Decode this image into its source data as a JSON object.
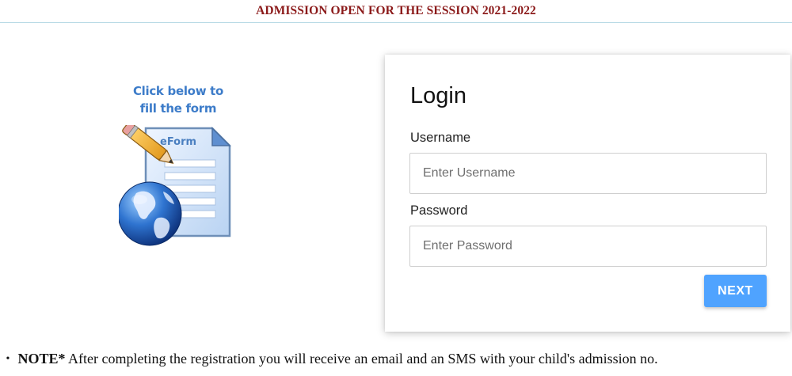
{
  "banner": {
    "title": "ADMISSION OPEN FOR THE SESSION 2021-2022"
  },
  "eform": {
    "caption_line1": "Click below to",
    "caption_line2": "fill the form",
    "doc_label": "eForm",
    "icon": "eform-document-globe-pencil-icon"
  },
  "login": {
    "title": "Login",
    "username_label": "Username",
    "username_placeholder": "Enter Username",
    "password_label": "Password",
    "password_placeholder": "Enter Password",
    "next_label": "NEXT"
  },
  "note": {
    "bullet": "•",
    "label": "NOTE*",
    "text": " After completing the registration you will receive an email and an SMS with your child's admission no."
  },
  "colors": {
    "banner_title": "#8b1a1a",
    "caption": "#3d7cc9",
    "next_button": "#4fa3ff"
  }
}
